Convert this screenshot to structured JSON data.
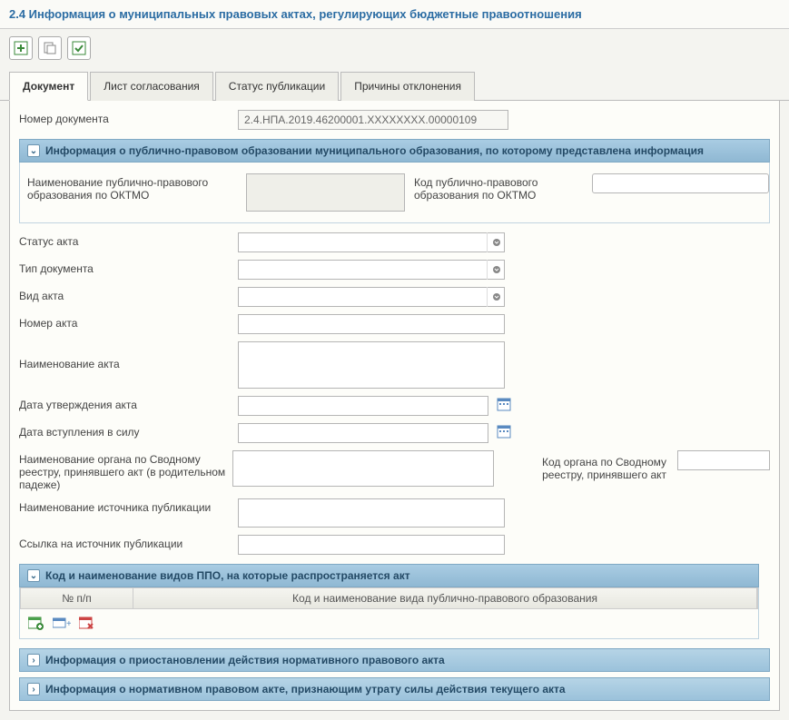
{
  "page_title": "2.4 Информация о муниципальных правовых актах, регулирующих бюджетные правоотношения",
  "tabs": {
    "document": "Документ",
    "approval": "Лист согласования",
    "status": "Статус публикации",
    "reasons": "Причины отклонения"
  },
  "labels": {
    "doc_number": "Номер документа",
    "section1": "Информация о публично-правовом образовании муниципального образования, по которому представлена информация",
    "ppo_name": "Наименование публично-правового образования по ОКТМО",
    "ppo_code": "Код публично-правового образования по ОКТМО",
    "act_status": "Статус акта",
    "doc_type": "Тип документа",
    "act_kind": "Вид акта",
    "act_number": "Номер акта",
    "act_name": "Наименование акта",
    "approval_date": "Дата утверждения акта",
    "effect_date": "Дата вступления в силу",
    "organ_name": "Наименование органа по Сводному реестру, принявшего акт (в родительном падеже)",
    "organ_code": "Код органа по Сводному реестру, принявшего акт",
    "source_name": "Наименование источника публикации",
    "source_link": "Ссылка на источник публикации",
    "section2": "Код и наименование видов ППО, на которые распространяется акт",
    "grid_col1": "№ п/п",
    "grid_col2": "Код и наименование вида публично-правового образования",
    "section3": "Информация о приостановлении действия нормативного правового акта",
    "section4": "Информация о нормативном правовом акте, признающим утрату силы действия текущего акта"
  },
  "values": {
    "doc_number": "2.4.НПА.2019.46200001.XXXXXXXX.00000109",
    "ppo_name": "",
    "ppo_code": "",
    "act_status": "",
    "doc_type": "",
    "act_kind": "",
    "act_number": "",
    "act_name": "",
    "approval_date": "",
    "effect_date": "",
    "organ_name": "",
    "organ_code": "",
    "source_name": "",
    "source_link": ""
  }
}
